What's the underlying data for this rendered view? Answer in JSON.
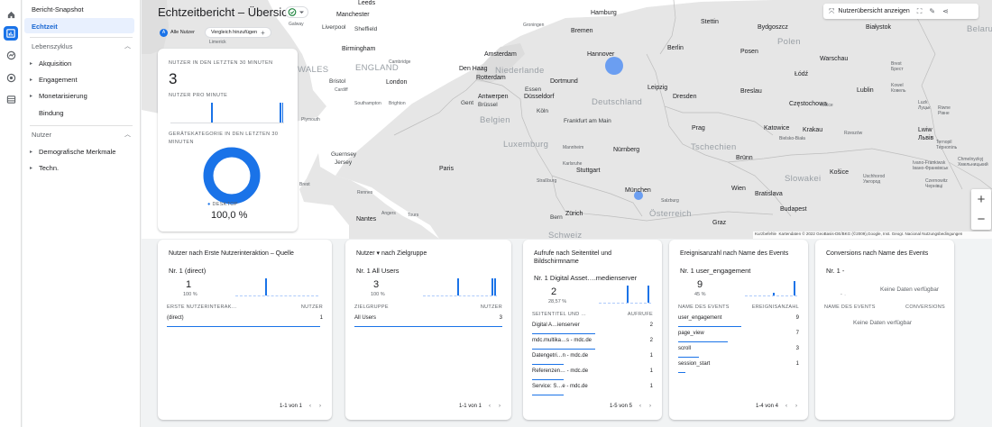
{
  "nav": {
    "snapshot": "Bericht-Snapshot",
    "realtime": "Echtzeit",
    "lifecycle": "Lebenszyklus",
    "lifecycle_items": [
      "Akquisition",
      "Engagement",
      "Monetarisierung",
      "Bindung"
    ],
    "user": "Nutzer",
    "user_items": [
      "Demografische Merkmale",
      "Techn."
    ]
  },
  "header": {
    "title": "Echtzeitbericht – Übersicht",
    "all_users": "Alle Nutzer",
    "all_users_avatar": "A",
    "compare": "Vergleich hinzufügen",
    "show_overview": "Nutzerübersicht anzeigen"
  },
  "map": {
    "labels": {
      "leeds": "Leeds",
      "manchester": "Manchester",
      "galway": "Galway",
      "liverpool": "Liverpool",
      "sheffield": "Sheffield",
      "limerick": "Limerick",
      "birmingham": "Birmingham",
      "wales": "WALES",
      "england": "ENGLAND",
      "cambridge": "Cambridge",
      "cardiff": "Cardiff",
      "bristol": "Bristol",
      "london": "London",
      "southampton": "Southampton",
      "brighton": "Brighton",
      "plymouth": "Plymouth",
      "guernsey": "Guernsey",
      "jersey": "Jersey",
      "brest": "Brest",
      "rennes": "Rennes",
      "nantes": "Nantes",
      "angers": "Angers",
      "tours": "Tours",
      "paris": "Paris",
      "hamburg": "Hamburg",
      "bremen": "Bremen",
      "groningen": "Groningen",
      "amsterdam": "Amsterdam",
      "hannover": "Hannover",
      "denhaag": "Den Haag",
      "niederlande": "Niederlande",
      "rotterdam": "Rotterdam",
      "dortmund": "Dortmund",
      "essen": "Essen",
      "antwerpen": "Antwerpen",
      "duesseldorf": "Düsseldorf",
      "gent": "Gent",
      "brussel": "Brüssel",
      "koeln": "Köln",
      "belgien": "Belgien",
      "luxemburg": "Luxemburg",
      "frankfurt": "Frankfurt am Main",
      "deutschland": "Deutschland",
      "leipzig": "Leipzig",
      "dresden": "Dresden",
      "mannheim": "Mannheim",
      "nuernberg": "Nürnberg",
      "karlsruhe": "Karlsruhe",
      "stuttgart": "Stuttgart",
      "strassburg": "Straßburg",
      "muenchen": "München",
      "zuerich": "Zürich",
      "bern": "Bern",
      "schweiz": "Schweiz",
      "salzburg": "Salzburg",
      "oesterreich": "Österreich",
      "graz": "Graz",
      "wien": "Wien",
      "stettin": "Stettin",
      "bydgoszcz": "Bydgoszcz",
      "bialystok": "Białystok",
      "polen": "Polen",
      "berlin": "Berlin",
      "posen": "Posen",
      "warschau": "Warschau",
      "lodz": "Łódź",
      "breslau": "Breslau",
      "czestochowa": "Częstochowa",
      "kielce": "Kielce",
      "lublin": "Lublin",
      "prag": "Prag",
      "katowice": "Katowice",
      "krakau": "Krakau",
      "rzeszow": "Rzeszów",
      "bielsko": "Bielsko-Biała",
      "tschechien": "Tschechien",
      "bruenn": "Brünn",
      "slowakei": "Slowakei",
      "kosice": "Košice",
      "bratislava": "Bratislava",
      "budapest": "Budapest",
      "lwiw": "Lwiw",
      "lwiw2": "Львів",
      "brest_by": "Brest",
      "brest_by2": "Брест",
      "kowel": "Kowel",
      "kowel2": "Ковель",
      "ternopil": "Ternopil",
      "ternopil2": "Тернопіль",
      "chmelnyzkyj": "Chmelnyzkyj",
      "chmelnyzkyj2": "Хмельницький",
      "ivano": "Ivano-Frankiwsk",
      "ivano2": "Івано-Франківськ",
      "uschhorod": "Uschhorod",
      "uschhorod2": "Ужгород",
      "czernowitz": "Czernowitz",
      "czernowitz2": "Чернівці",
      "luzk": "Luzk",
      "luzk2": "Луцьк",
      "riwne": "Riwne",
      "riwne2": "Рівне",
      "belarus": "Belaru"
    },
    "keyboard": "Kurzbefehle",
    "attribution": "Kartendaten © 2022 GeoBasis-DE/BKG (©2009),Google, Inst. Geogr. Nacional   Nutzungsbedingungen"
  },
  "realtime": {
    "users_label": "NUTZER IN DEN LETZTEN 30 MINUTEN",
    "users_value": "3",
    "per_minute_label": "NUTZER PRO MINUTE",
    "device_label": "GERÄTEKATEGORIE IN DEN LETZTEN 30 MINUTEN",
    "device_legend": "DESKTOP",
    "device_value": "100,0 %",
    "desktop_share": 100,
    "per_minute_values": [
      0,
      0,
      0,
      0,
      0,
      0,
      0,
      0,
      0,
      0,
      0,
      0,
      0,
      0,
      0,
      0,
      0,
      0,
      0,
      1,
      0,
      0,
      0,
      0,
      0,
      0,
      0,
      0,
      0,
      0,
      0,
      0,
      0,
      0,
      0,
      0,
      0,
      0,
      0,
      0,
      0,
      0,
      0,
      0,
      0,
      0,
      0,
      0,
      0,
      0,
      0,
      1,
      1
    ],
    "accent": "#1a73e8"
  },
  "cards": [
    {
      "title": "Nutzer nach Erste Nutzerinteraktion – Quelle",
      "rank": "Nr. 1  (direct)",
      "value": "1",
      "percent": "100 %",
      "spark": [
        0,
        0,
        0,
        0,
        0,
        0,
        0,
        0,
        0,
        0,
        1,
        0,
        0,
        0,
        0,
        0,
        0,
        0,
        0,
        0,
        0,
        0,
        0,
        0,
        0,
        0,
        0,
        0
      ],
      "col1": "ERSTE NUTZERINTERAK…",
      "col2": "NUTZER",
      "rows": [
        {
          "label": "(direct)",
          "value": "1",
          "share": 100
        }
      ],
      "pager": "1-1 von 1"
    },
    {
      "title": "Nutzer ▾ nach Zielgruppe",
      "rank": "Nr. 1  All Users",
      "value": "3",
      "percent": "100 %",
      "spark": [
        0,
        0,
        0,
        0,
        0,
        0,
        0,
        0,
        0,
        0,
        0,
        0,
        0,
        1,
        0,
        0,
        0,
        0,
        0,
        0,
        0,
        0,
        0,
        0,
        0,
        0,
        1,
        1
      ],
      "col1": "ZIELGRUPPE",
      "col2": "NUTZER",
      "rows": [
        {
          "label": "All Users",
          "value": "3",
          "share": 100
        }
      ],
      "pager": "1-1 von 1"
    },
    {
      "title": "Aufrufe nach Seitentitel und Bildschirmname",
      "rank": "Nr. 1  Digital Asset….medienserver",
      "value": "2",
      "percent": "28,57 %",
      "spark": [
        0,
        0,
        0,
        0,
        0,
        0,
        0,
        0,
        0,
        0,
        0,
        0,
        0,
        0,
        0,
        1,
        0,
        0,
        0,
        0,
        0,
        0,
        0,
        0,
        0,
        0,
        1,
        0
      ],
      "col1": "SEITENTITEL UND …",
      "col2": "AUFRUFE",
      "rows": [
        {
          "label": "Digital A…ienserver",
          "value": "2",
          "share": 100
        },
        {
          "label": "mdc.multika…s - mdc.de",
          "value": "2",
          "share": 100
        },
        {
          "label": "Datengetri…n - mdc.de",
          "value": "1",
          "share": 50
        },
        {
          "label": "Referenzen… - mdc.de",
          "value": "1",
          "share": 50
        },
        {
          "label": "Service: S…e - mdc.de",
          "value": "1",
          "share": 50
        }
      ],
      "pager": "1-5 von 5"
    },
    {
      "title": "Ereignisanzahl nach Name des Events",
      "rank": "Nr. 1  user_engagement",
      "value": "9",
      "percent": "45 %",
      "spark": [
        0,
        0,
        0,
        0,
        0,
        0,
        0,
        0,
        0,
        0,
        0,
        0,
        0,
        0,
        0,
        0.15,
        0,
        0,
        0,
        0,
        0,
        0,
        0,
        0,
        0,
        0,
        0.85,
        0
      ],
      "col1": "NAME DES EVENTS",
      "col2": "EREIGNISANZAHL",
      "rows": [
        {
          "label": "user_engagement",
          "value": "9",
          "share": 100
        },
        {
          "label": "page_view",
          "value": "7",
          "share": 78
        },
        {
          "label": "scroll",
          "value": "3",
          "share": 33
        },
        {
          "label": "session_start",
          "value": "1",
          "share": 11
        }
      ],
      "pager": "1-4 von 4"
    },
    {
      "title": "Conversions nach Name des Events",
      "rank": "Nr. 1  -",
      "value": "",
      "percent": "-",
      "spark": [],
      "col1": "NAME DES EVENTS",
      "col2": "CONVERSIONS",
      "rows": [],
      "pager": "",
      "empty": "Keine Daten verfügbar"
    }
  ]
}
